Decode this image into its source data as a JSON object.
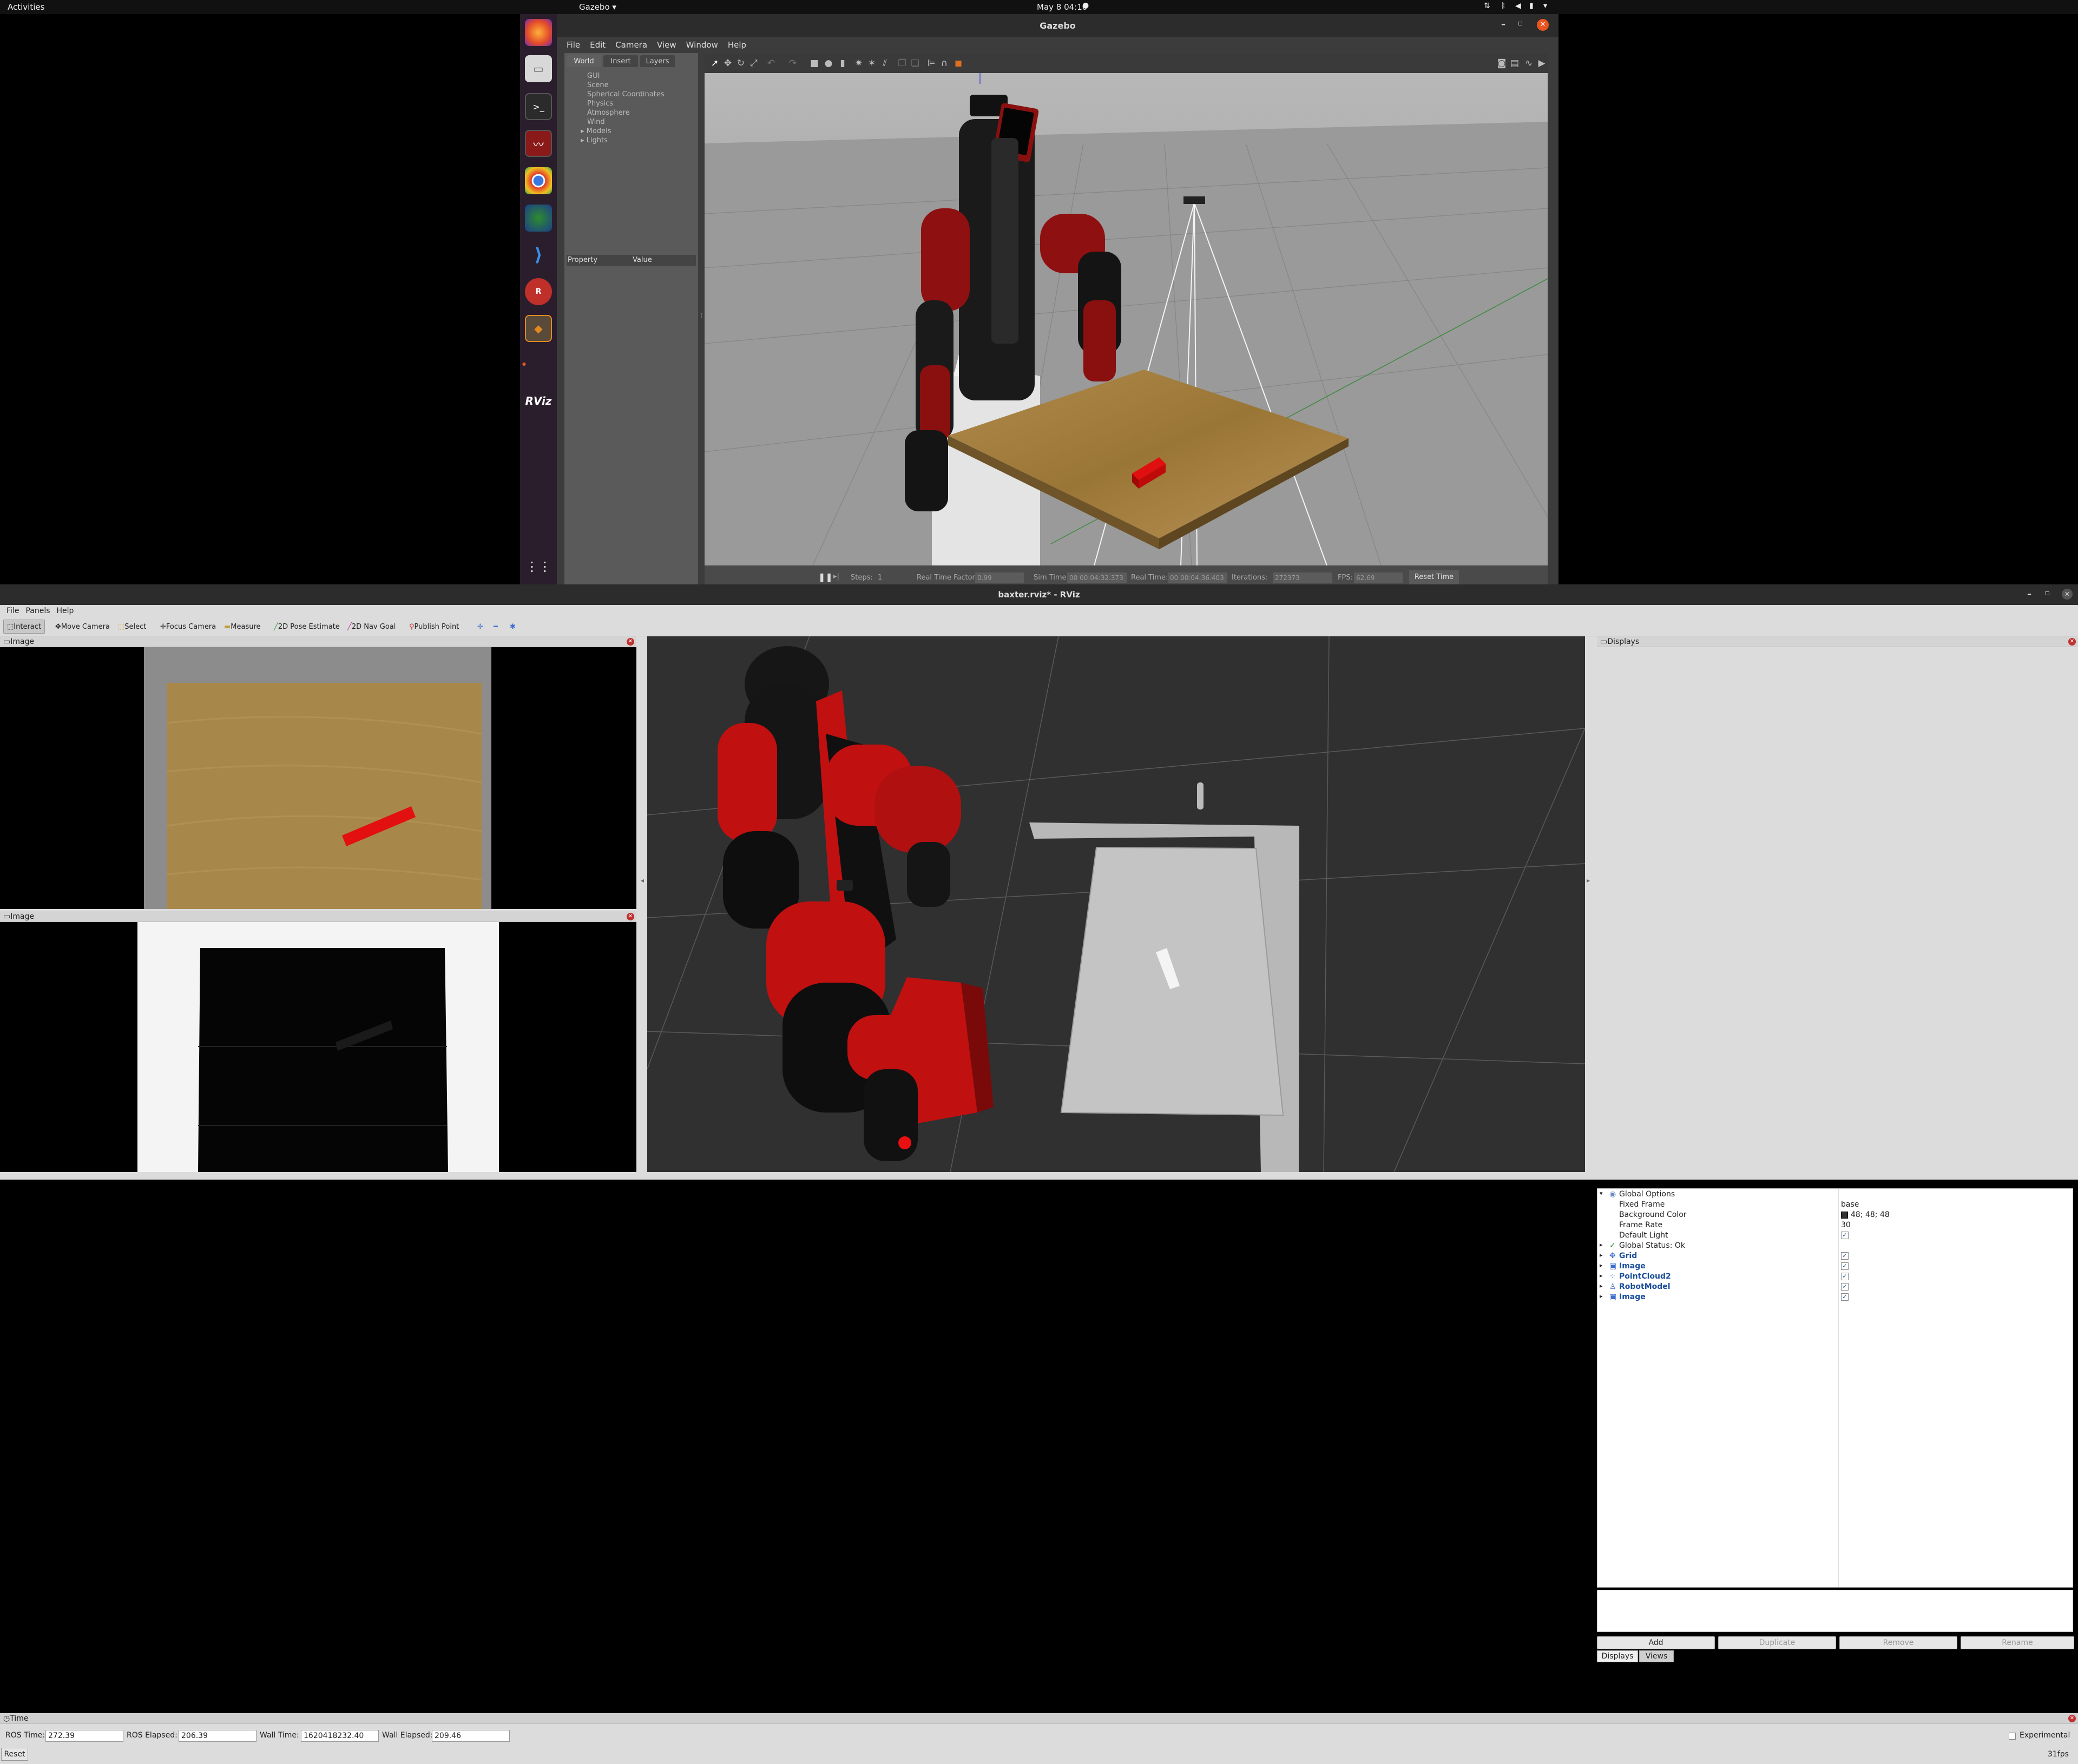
{
  "topbar": {
    "activities": "Activities",
    "app": "Gazebo",
    "datetime": "May 8  04:10"
  },
  "gazebo": {
    "title": "Gazebo",
    "menu": [
      "File",
      "Edit",
      "Camera",
      "View",
      "Window",
      "Help"
    ],
    "tabs": [
      "World",
      "Insert",
      "Layers"
    ],
    "tree": [
      "GUI",
      "Scene",
      "Spherical Coordinates",
      "Physics",
      "Atmosphere",
      "Wind",
      "Models",
      "Lights"
    ],
    "prop_header": {
      "property": "Property",
      "value": "Value"
    },
    "bottom": {
      "steps_label": "Steps:",
      "steps_value": "1",
      "rtf_label": "Real Time Factor:",
      "rtf_value": "0.99",
      "simtime_label": "Sim Time:",
      "simtime_value": "00 00:04:32.373",
      "realtime_label": "Real Time:",
      "realtime_value": "00 00:04:36.403",
      "iter_label": "Iterations:",
      "iter_value": "272373",
      "fps_label": "FPS:",
      "fps_value": "62.69",
      "reset": "Reset Time"
    }
  },
  "dock": {
    "rviz_label": "RViz"
  },
  "rviz": {
    "title": "baxter.rviz* - RViz",
    "menu": [
      "File",
      "Panels",
      "Help"
    ],
    "tools": [
      "Interact",
      "Move Camera",
      "Select",
      "Focus Camera",
      "Measure",
      "2D Pose Estimate",
      "2D Nav Goal",
      "Publish Point"
    ],
    "image1_title": "Image",
    "image2_title": "Image",
    "displays": {
      "title": "Displays",
      "global_options": "Global Options",
      "fixed_frame_label": "Fixed Frame",
      "fixed_frame_value": "base",
      "bg_label": "Background Color",
      "bg_value": "48; 48; 48",
      "framerate_label": "Frame Rate",
      "framerate_value": "30",
      "light_label": "Default Light",
      "status": "Global Status: Ok",
      "items": [
        "Grid",
        "Image",
        "PointCloud2",
        "RobotModel",
        "Image"
      ],
      "buttons": [
        "Add",
        "Duplicate",
        "Remove",
        "Rename"
      ],
      "tabs": [
        "Displays",
        "Views"
      ]
    },
    "time": {
      "title": "Time",
      "ros_time_label": "ROS Time:",
      "ros_time": "272.39",
      "ros_elapsed_label": "ROS Elapsed:",
      "ros_elapsed": "206.39",
      "wall_time_label": "Wall Time:",
      "wall_time": "1620418232.40",
      "wall_elapsed_label": "Wall Elapsed:",
      "wall_elapsed": "209.46",
      "experimental": "Experimental",
      "reset": "Reset",
      "fps": "31fps"
    }
  },
  "colors": {
    "robot_red": "#a01010",
    "table": "#9a7a3e",
    "block": "#e01010",
    "rviz_bg": "#303030"
  }
}
